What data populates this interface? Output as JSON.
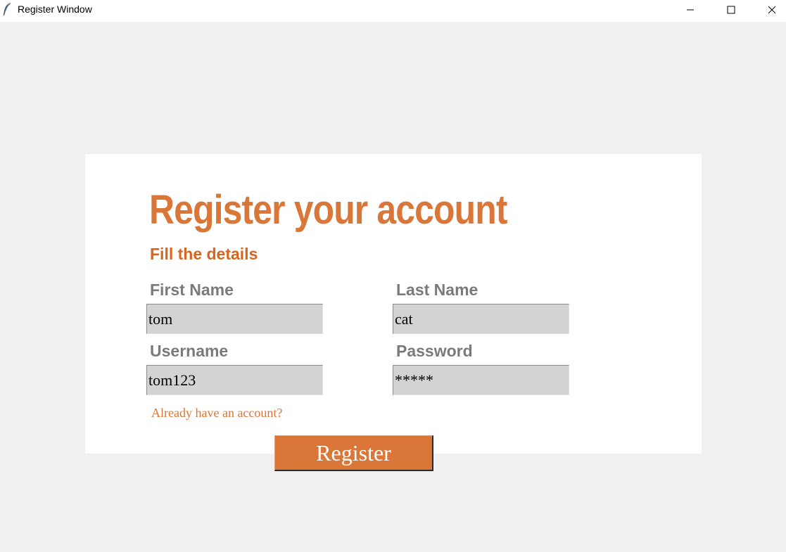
{
  "window": {
    "title": "Register Window",
    "icon": "feather-icon"
  },
  "form": {
    "heading": "Register your account",
    "subheading": "Fill the details",
    "first_name": {
      "label": "First Name",
      "value": "tom"
    },
    "last_name": {
      "label": "Last Name",
      "value": "cat"
    },
    "username": {
      "label": "Username",
      "value": "tom123"
    },
    "password": {
      "label": "Password",
      "value": "*****"
    },
    "login_link": "Already have an account?",
    "register_label": "Register"
  },
  "colors": {
    "accent": "#d97638",
    "field_bg": "#d3d3d3",
    "label": "#7a7a7a",
    "background": "#f0f0f0"
  }
}
